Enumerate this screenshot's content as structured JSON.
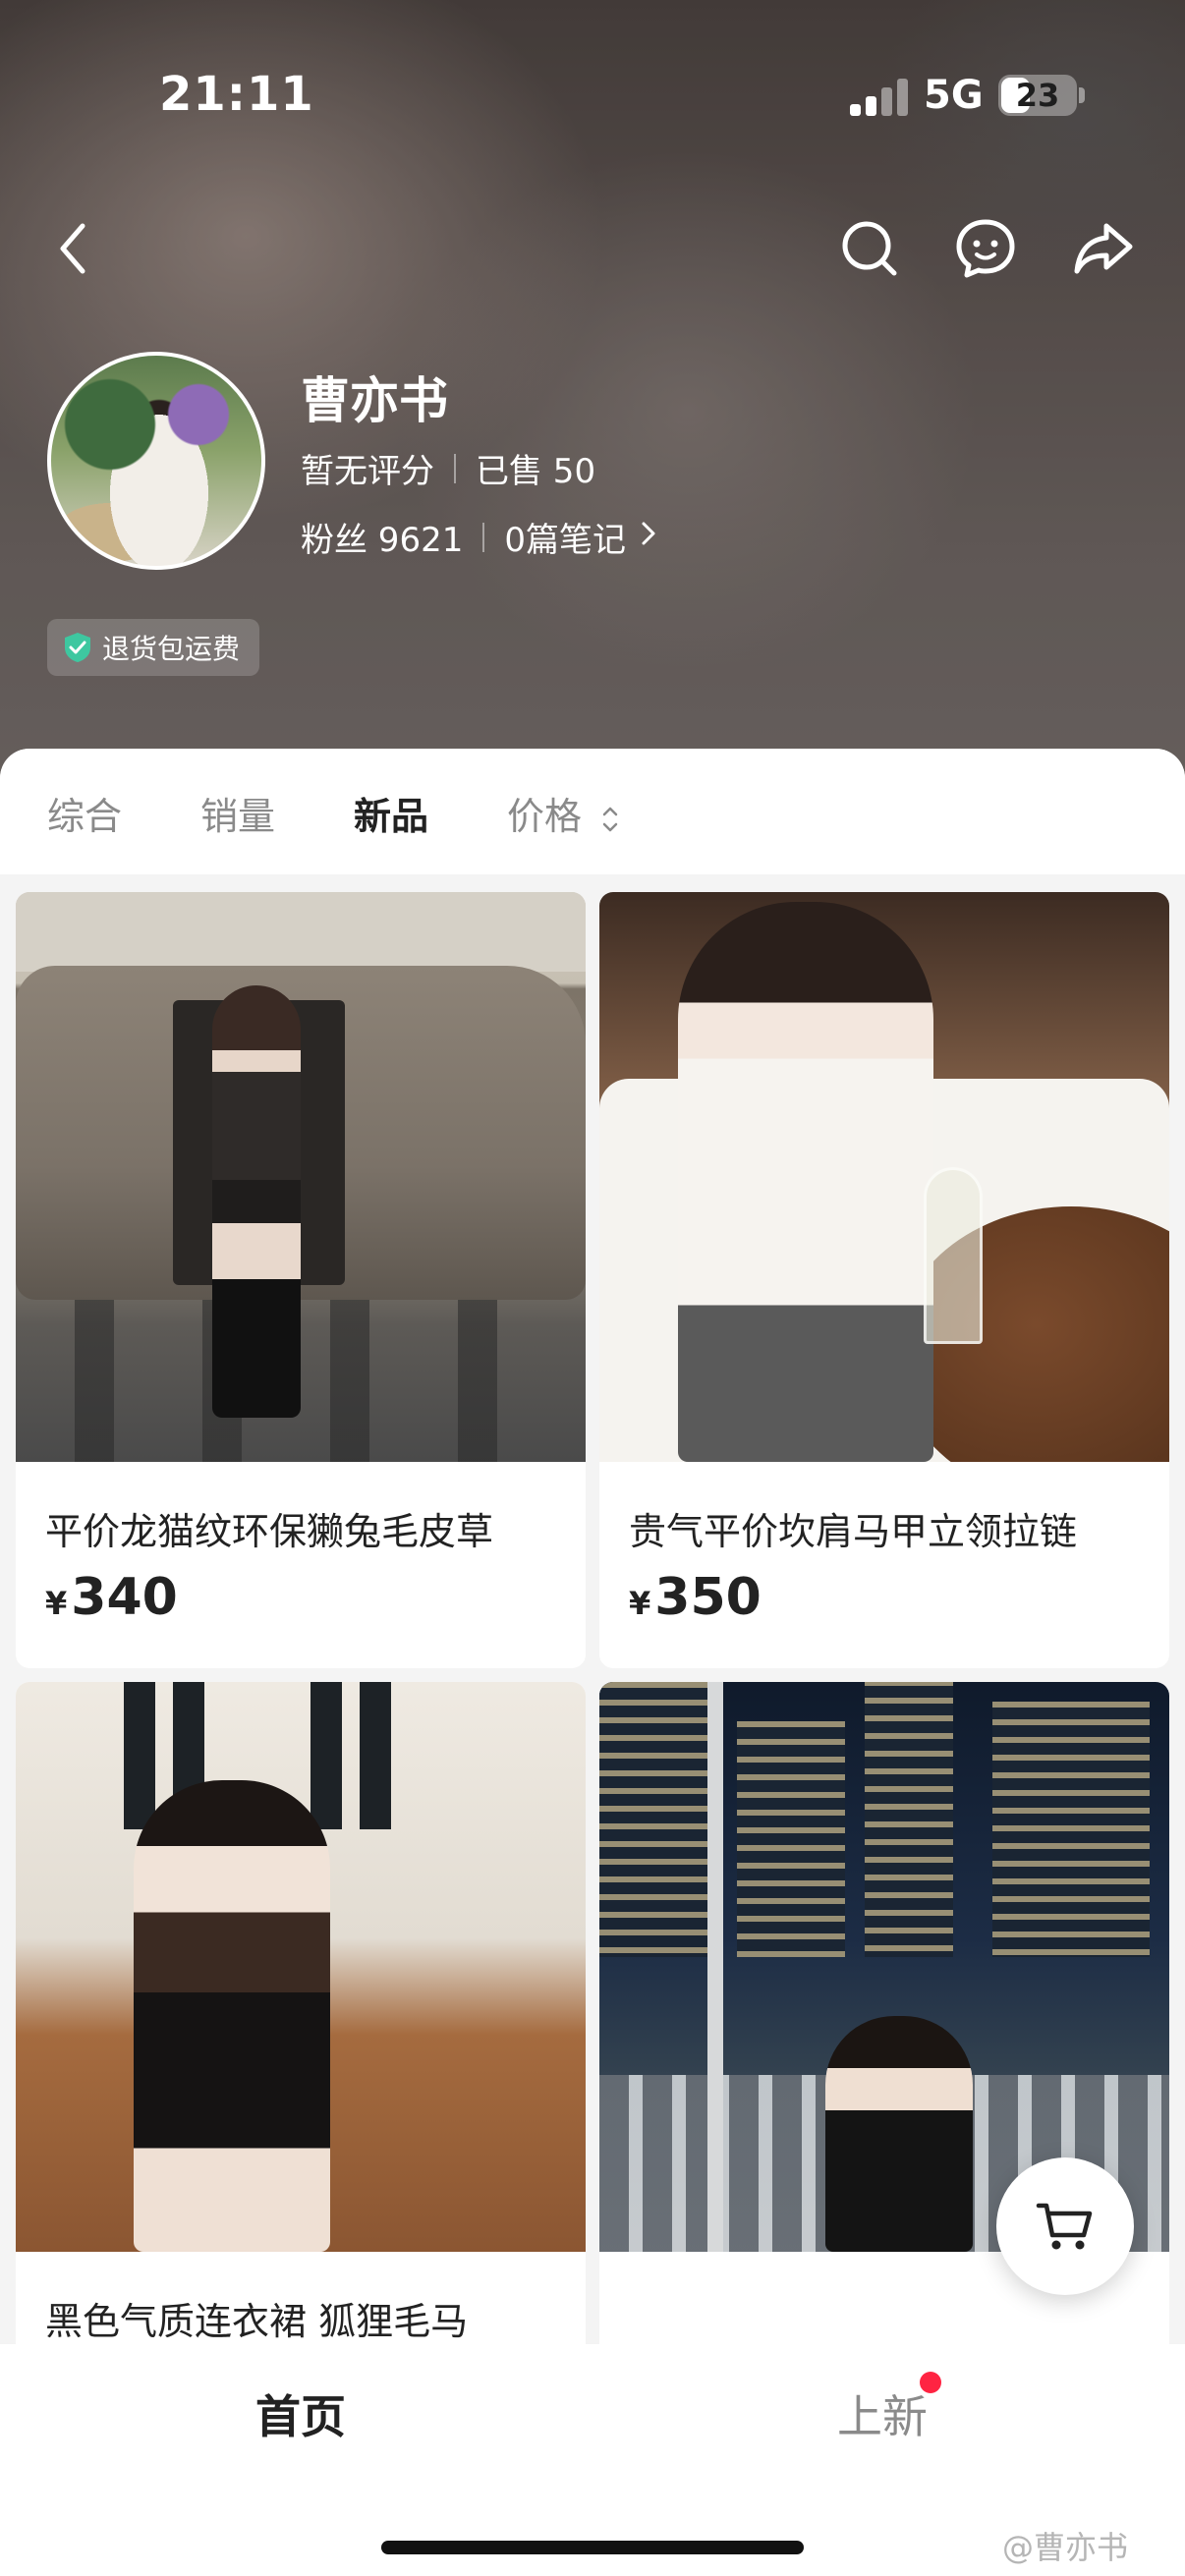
{
  "status_bar": {
    "time": "21:11",
    "network": "5G",
    "battery": "23"
  },
  "icons": {
    "back": "back-arrow-icon",
    "search": "search-icon",
    "customer_service": "chat-bubble-icon",
    "share": "share-icon",
    "cart": "cart-icon",
    "badge": "shield-check-icon"
  },
  "shop": {
    "name": "曹亦书",
    "rating": "暂无评分",
    "sold": "已售 50",
    "followers": "粉丝 9621",
    "notes": "0篇笔记",
    "badge": "退货包运费"
  },
  "sort_tabs": [
    {
      "label": "综合",
      "active": false
    },
    {
      "label": "销量",
      "active": false
    },
    {
      "label": "新品",
      "active": true
    },
    {
      "label": "价格",
      "active": false
    }
  ],
  "products": [
    {
      "title": "平价龙猫纹环保獭兔毛皮草",
      "currency": "¥",
      "price": "340"
    },
    {
      "title": "贵气平价坎肩马甲立领拉链",
      "currency": "¥",
      "price": "350"
    },
    {
      "title": "黑色气质连衣裙  狐狸毛马",
      "currency": "",
      "price": ""
    },
    {
      "title": "",
      "currency": "",
      "price": ""
    }
  ],
  "bottom_tabs": [
    {
      "label": "首页",
      "active": true
    },
    {
      "label": "上新",
      "active": false,
      "dot": true
    }
  ],
  "watermark": "@曹亦书",
  "colors": {
    "accent_red": "#ff2442",
    "badge_icon": "#3ec7a0"
  }
}
